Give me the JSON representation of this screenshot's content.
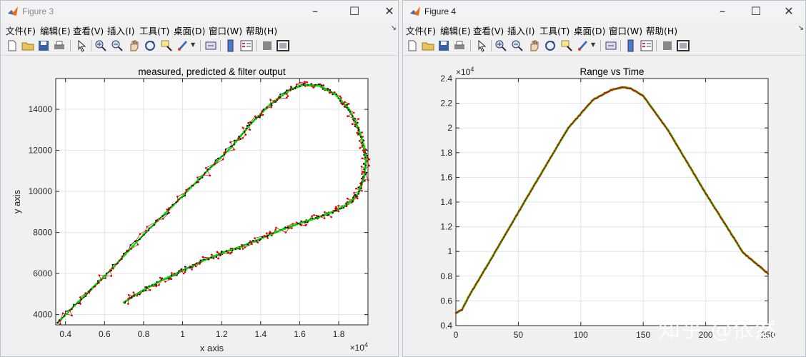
{
  "windows": [
    {
      "title": "Figure 3",
      "menu": [
        "文件(F)",
        "编辑(E)",
        "查看(V)",
        "插入(I)",
        "工具(T)",
        "桌面(D)",
        "窗口(W)",
        "帮助(H)"
      ],
      "chart_data": {
        "type": "scatter",
        "title": "measured, predicted & filter output",
        "xlabel": "x axis",
        "ylabel": "y axis",
        "x_exponent": "×10^4",
        "xlim": [
          3500,
          19500
        ],
        "ylim": [
          3500,
          15500
        ],
        "x_ticks": [
          4000,
          6000,
          8000,
          10000,
          12000,
          14000,
          16000,
          18000
        ],
        "x_tick_labels": [
          "0.4",
          "0.6",
          "0.8",
          "1",
          "1.2",
          "1.4",
          "1.6",
          "1.8"
        ],
        "y_ticks": [
          4000,
          6000,
          8000,
          10000,
          12000,
          14000
        ],
        "y_tick_labels": [
          "4000",
          "6000",
          "8000",
          "10000",
          "12000",
          "14000"
        ],
        "grid": true,
        "trajectory": {
          "x": [
            3600,
            5000,
            6500,
            8000,
            9500,
            11000,
            12500,
            13500,
            14500,
            15500,
            16200,
            17000,
            17800,
            18500,
            19000,
            19300,
            19400,
            19300,
            19000,
            18500,
            17800,
            17000,
            16000,
            15000,
            14000,
            13000,
            12000,
            11000,
            10000,
            9000,
            8000,
            7000
          ],
          "y": [
            3600,
            4950,
            6350,
            7900,
            9300,
            10750,
            12150,
            13300,
            14250,
            14950,
            15200,
            15150,
            14750,
            14050,
            13100,
            12200,
            11500,
            10700,
            9900,
            9400,
            9050,
            8750,
            8450,
            8100,
            7700,
            7300,
            7000,
            6600,
            6150,
            5700,
            5200,
            4600
          ]
        },
        "series": [
          {
            "name": "",
            "color": "#00dd00"
          },
          {
            "name": "",
            "color": "#000000"
          },
          {
            "name": "",
            "color": "#dd0000"
          }
        ]
      }
    },
    {
      "title": "Figure 4",
      "menu": [
        "文件(F)",
        "编辑(E)",
        "查看(V)",
        "插入(I)",
        "工具(T)",
        "桌面(D)",
        "窗口(W)",
        "帮助(H)"
      ],
      "chart_data": {
        "type": "line",
        "title": "Range vs Time",
        "xlabel": "",
        "ylabel": "",
        "y_exponent": "×10^4",
        "xlim": [
          0,
          250
        ],
        "ylim": [
          4000,
          24000
        ],
        "x_ticks": [
          0,
          50,
          100,
          150,
          200,
          250
        ],
        "x_tick_labels": [
          "0",
          "50",
          "100",
          "150",
          "200",
          "250"
        ],
        "y_ticks": [
          4000,
          6000,
          8000,
          10000,
          12000,
          14000,
          16000,
          18000,
          20000,
          22000,
          24000
        ],
        "y_tick_labels": [
          "0.4",
          "0.6",
          "0.8",
          "1",
          "1.2",
          "1.4",
          "1.6",
          "1.8",
          "2",
          "2.2",
          "2.4"
        ],
        "grid": true,
        "x": [
          0,
          5,
          10,
          30,
          60,
          90,
          110,
          125,
          135,
          140,
          150,
          170,
          200,
          230,
          250
        ],
        "y": [
          5000,
          5300,
          6300,
          9700,
          14900,
          20000,
          22300,
          23100,
          23300,
          23200,
          22600,
          19800,
          14700,
          9900,
          8200
        ],
        "series": [
          {
            "name": "",
            "color": "#00dd00"
          },
          {
            "name": "",
            "color": "#dd0000"
          }
        ]
      }
    }
  ],
  "watermark": "知乎 @依然"
}
